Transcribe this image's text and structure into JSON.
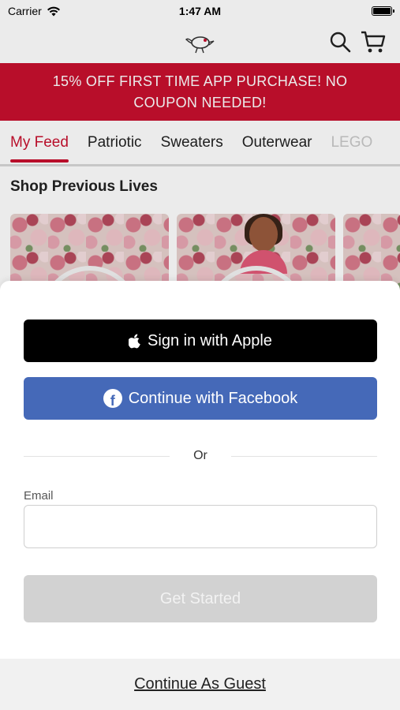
{
  "status_bar": {
    "carrier": "Carrier",
    "time": "1:47 AM"
  },
  "header": {
    "logo_icon": "bird-logo-icon",
    "search_icon": "search-icon",
    "cart_icon": "cart-icon"
  },
  "promo": {
    "text": "15% OFF FIRST TIME APP PURCHASE! NO COUPON NEEDED!",
    "color": "#c8102e"
  },
  "tabs": [
    {
      "label": "My Feed",
      "active": true
    },
    {
      "label": "Patriotic"
    },
    {
      "label": "Sweaters"
    },
    {
      "label": "Outerwear"
    },
    {
      "label": "LEGO"
    }
  ],
  "section": {
    "title": "Shop Previous Lives"
  },
  "auth": {
    "apple_label": "Sign in with Apple",
    "facebook_label": "Continue with Facebook",
    "divider_text": "Or",
    "email_label": "Email",
    "email_value": "",
    "email_placeholder": "",
    "get_started_label": "Get Started",
    "guest_label": "Continue As Guest",
    "colors": {
      "apple": "#000000",
      "facebook": "#4569b8",
      "disabled": "#d2d2d2"
    }
  }
}
